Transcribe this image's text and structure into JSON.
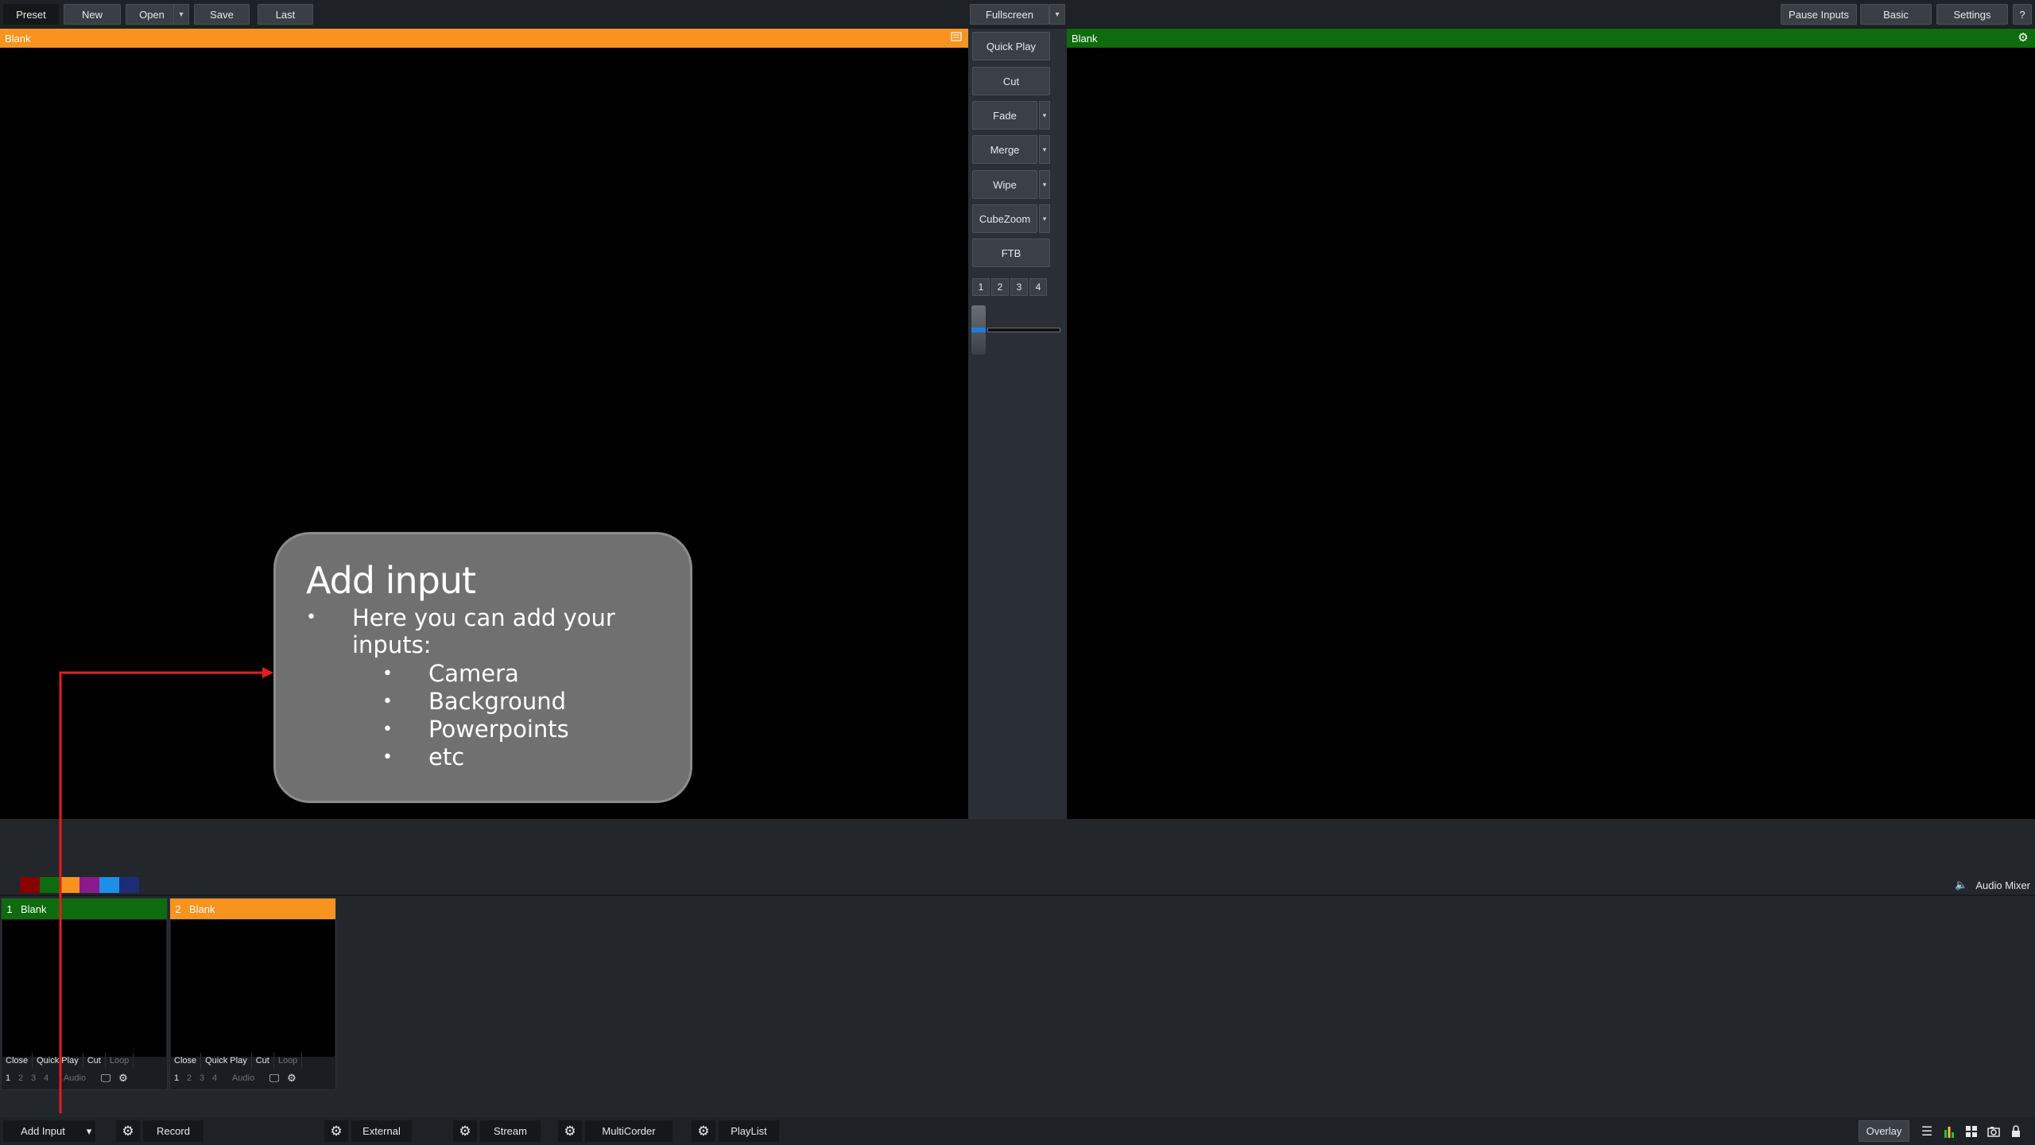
{
  "topbar": {
    "preset": "Preset",
    "new": "New",
    "open": "Open",
    "save": "Save",
    "last": "Last",
    "fullscreen": "Fullscreen",
    "pause_inputs": "Pause Inputs",
    "basic": "Basic",
    "settings": "Settings",
    "help": "?"
  },
  "preview": {
    "title": "Blank",
    "header_color": "#f7931e"
  },
  "output": {
    "title": "Blank",
    "header_color": "#0e6b0e"
  },
  "transitions": {
    "quick_play": "Quick Play",
    "cut": "Cut",
    "fade": "Fade",
    "merge": "Merge",
    "wipe": "Wipe",
    "cubezoom": "CubeZoom",
    "ftb": "FTB",
    "numbers": [
      "1",
      "2",
      "3",
      "4"
    ]
  },
  "color_swatches": [
    "#23272c",
    "#8b0000",
    "#0e6b0e",
    "#f7931e",
    "#8a1a8a",
    "#1e8fe6",
    "#1c2d78"
  ],
  "audio_mixer": {
    "label": "Audio Mixer"
  },
  "inputs": [
    {
      "number": "1",
      "title": "Blank",
      "header_color": "#0e6b0e",
      "close": "Close",
      "quick_play": "Quick Play",
      "cut": "Cut",
      "loop": "Loop",
      "nums": [
        "1",
        "2",
        "3",
        "4"
      ],
      "audio": "Audio"
    },
    {
      "number": "2",
      "title": "Blank",
      "header_color": "#f7931e",
      "close": "Close",
      "quick_play": "Quick Play",
      "cut": "Cut",
      "loop": "Loop",
      "nums": [
        "1",
        "2",
        "3",
        "4"
      ],
      "audio": "Audio"
    }
  ],
  "bottombar": {
    "add_input": "Add Input",
    "record": "Record",
    "external": "External",
    "stream": "Stream",
    "multicorder": "MultiCorder",
    "playlist": "PlayList",
    "overlay": "Overlay"
  },
  "callout": {
    "title": "Add input",
    "intro": "Here you can add your inputs:",
    "items": [
      "Camera",
      "Background",
      "Powerpoints",
      "etc"
    ],
    "arrow_color": "#e31e1e"
  }
}
